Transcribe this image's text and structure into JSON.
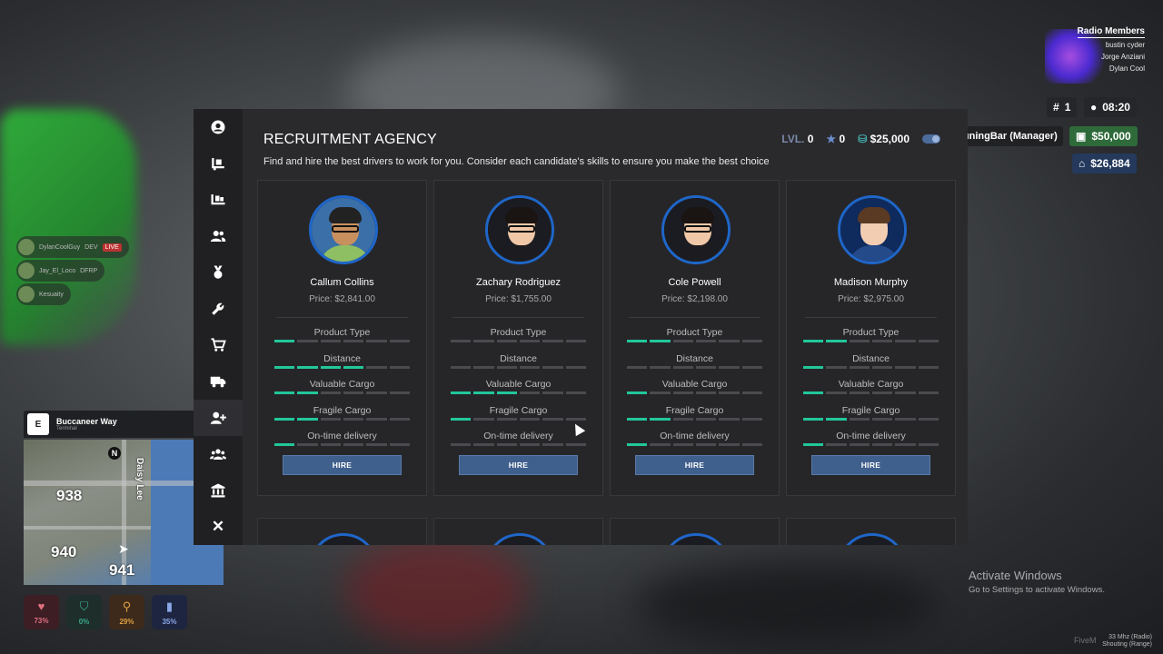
{
  "radio": {
    "title": "Radio Members",
    "members": [
      "bustin cyder",
      "Jorge Anziani",
      "Dylan Cool"
    ]
  },
  "hud": {
    "player_id_icon": "hash-icon",
    "player_id": "1",
    "clock_icon": "clock-icon",
    "time": "08:20",
    "job": "TuningBar (Manager)",
    "cash": "$50,000",
    "bank": "$26,884"
  },
  "players": [
    {
      "name": "DylanCoolGuy",
      "tag": "DEV",
      "live": "LIVE"
    },
    {
      "name": "Jay_El_Loco",
      "tag": "DFRP",
      "live": ""
    },
    {
      "name": "Kesuaity",
      "tag": "",
      "live": ""
    }
  ],
  "minimap": {
    "key": "E",
    "street": "Buccaneer Way",
    "area": "Terminal",
    "compass": "N",
    "road_label": "Daisy Lee",
    "zones": [
      "938",
      "940",
      "941"
    ]
  },
  "status": [
    {
      "icon": "heart-icon",
      "value": "73%",
      "color": "#8c2a3a",
      "bg": "#3c1e24"
    },
    {
      "icon": "shield-icon",
      "value": "0%",
      "color": "#2a8c6a",
      "bg": "#1e2e2a"
    },
    {
      "icon": "food-icon",
      "value": "29%",
      "color": "#d28a2a",
      "bg": "#3d2a1a"
    },
    {
      "icon": "water-icon",
      "value": "35%",
      "color": "#6a8cd2",
      "bg": "#1e2540"
    }
  ],
  "windows": {
    "activate_title": "Activate Windows",
    "activate_sub": "Go to Settings to activate Windows.",
    "fivem": "FiveM",
    "corner_line1": "33 Mhz (Radio)",
    "corner_line2": "Shouting (Range)"
  },
  "panel": {
    "title": "RECRUITMENT AGENCY",
    "subtitle": "Find and hire the best drivers to work for you. Consider each candidate's skills to ensure you make the best choice",
    "level_label": "LVL.",
    "level": "0",
    "stars": "0",
    "money": "$25,000",
    "sidebar": [
      "user-icon",
      "truck-loading-icon",
      "pallet-icon",
      "users-icon",
      "medal-icon",
      "wrench-icon",
      "cart-icon",
      "truck-icon",
      "user-plus-icon",
      "group-icon",
      "bank-icon",
      "close-icon"
    ],
    "active_index": 8,
    "skill_labels": [
      "Product Type",
      "Distance",
      "Valuable Cargo",
      "Fragile Cargo",
      "On-time delivery"
    ],
    "hire_label": "HIRE",
    "candidates": [
      {
        "name": "Callum Collins",
        "price": "Price: $2,841.00",
        "skills": [
          1,
          4,
          2,
          2,
          1
        ],
        "skin": "#c8905e",
        "body": "#8fbf63",
        "bg": "#3b6fa8",
        "hair": "#222",
        "glasses": true
      },
      {
        "name": "Zachary Rodriguez",
        "price": "Price: $1,755.00",
        "skills": [
          0,
          0,
          3,
          1,
          0
        ],
        "skin": "#f0c8a8",
        "body": "#1c1c20",
        "bg": "#1b1c22",
        "hair": "#1a1412",
        "glasses": true
      },
      {
        "name": "Cole Powell",
        "price": "Price: $2,198.00",
        "skills": [
          2,
          0,
          1,
          2,
          1
        ],
        "skin": "#f0c8a8",
        "body": "#1c1c20",
        "bg": "#1b1c22",
        "hair": "#1a1412",
        "glasses": true
      },
      {
        "name": "Madison Murphy",
        "price": "Price: $2,975.00",
        "skills": [
          2,
          1,
          1,
          2,
          1
        ],
        "skin": "#f2cdb2",
        "body": "#244a8a",
        "bg": "#0f2a5c",
        "hair": "#5a3a22",
        "glasses": false
      }
    ]
  }
}
